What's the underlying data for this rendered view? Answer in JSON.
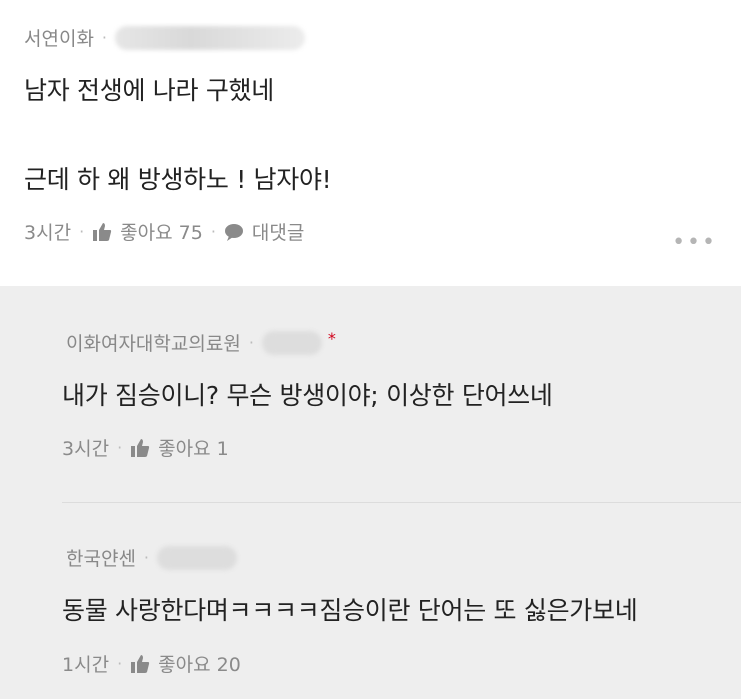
{
  "main_comment": {
    "author": "서연이화",
    "line1": "남자 전생에 나라 구했네",
    "line2": "근데 하 왜 방생하노 ! 남자야!",
    "time": "3시간",
    "like_label": "좋아요 75",
    "reply_label": "대댓글",
    "more": "•••"
  },
  "replies": [
    {
      "author": "이화여자대학교의료원",
      "text": "내가 짐승이니? 무슨 방생이야; 이상한 단어쓰네",
      "time": "3시간",
      "like_label": "좋아요 1",
      "marker": "*"
    },
    {
      "author": "한국얀센",
      "text": "동물 사랑한다며ㅋㅋㅋㅋ짐승이란 단어는 또 싫은가보네",
      "time": "1시간",
      "like_label": "좋아요 20"
    }
  ],
  "icons": {
    "like": "thumbs-up-icon",
    "reply": "speech-bubble-icon"
  },
  "colors": {
    "reply_background": "#eeeeee",
    "meta_text": "#8a8a8a",
    "marker": "#d0021b"
  }
}
